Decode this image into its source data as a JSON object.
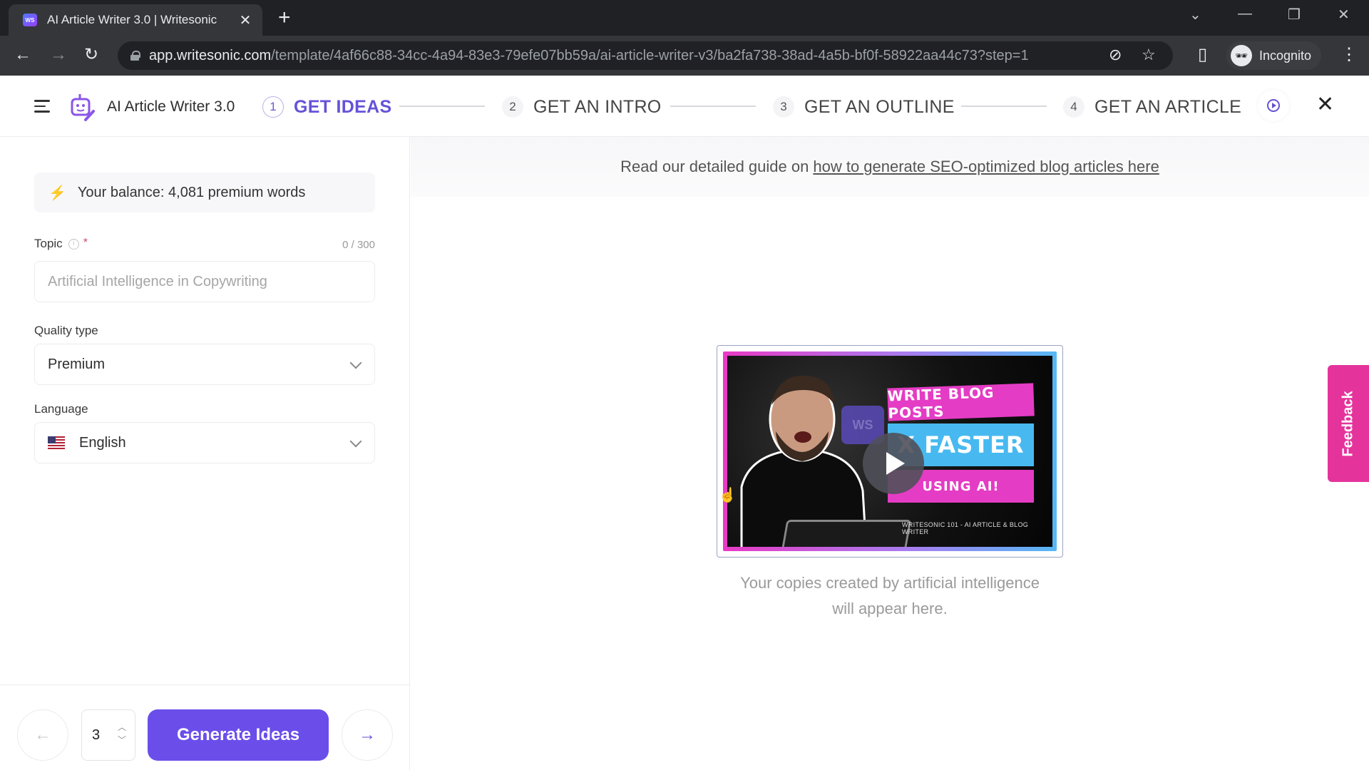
{
  "browser": {
    "tab_title": "AI Article Writer 3.0 | Writesonic",
    "favicon_text": "WS",
    "url_host": "app.writesonic.com",
    "url_path": "/template/4af66c88-34cc-4a94-83e3-79efe07bb59a/ai-article-writer-v3/ba2fa738-38ad-4a5b-bf0f-58922aa44c73?step=1",
    "profile_label": "Incognito"
  },
  "header": {
    "app_title": "AI Article Writer 3.0",
    "steps": [
      {
        "number": "1",
        "label": "GET IDEAS",
        "active": true
      },
      {
        "number": "2",
        "label": "GET AN INTRO",
        "active": false
      },
      {
        "number": "3",
        "label": "GET AN OUTLINE",
        "active": false
      },
      {
        "number": "4",
        "label": "GET AN ARTICLE",
        "active": false
      }
    ]
  },
  "form": {
    "balance_text": "Your balance: 4,081 premium words",
    "topic": {
      "label": "Topic",
      "required_mark": "*",
      "counter": "0 / 300",
      "placeholder": "Artificial Intelligence in Copywriting",
      "value": ""
    },
    "quality_type": {
      "label": "Quality type",
      "selected": "Premium"
    },
    "language": {
      "label": "Language",
      "selected": "English",
      "flag": "us-flag"
    },
    "count": "3",
    "generate_label": "Generate Ideas"
  },
  "main": {
    "guide_prefix": "Read our detailed guide on",
    "guide_link": "how to generate SEO-optimized blog articles here",
    "video": {
      "banner_line1": "WRITE BLOG POSTS",
      "banner_line2": "X FASTER",
      "banner_line3": "USING AI!",
      "caption": "WRITESONIC 101 - AI ARTICLE & BLOG WRITER",
      "logo_text": "WS"
    },
    "empty_line1": "Your copies created by artificial intelligence",
    "empty_line2": "will appear here."
  },
  "feedback_label": "Feedback",
  "colors": {
    "accent": "#6b4eea",
    "feedback": "#e4349c"
  }
}
